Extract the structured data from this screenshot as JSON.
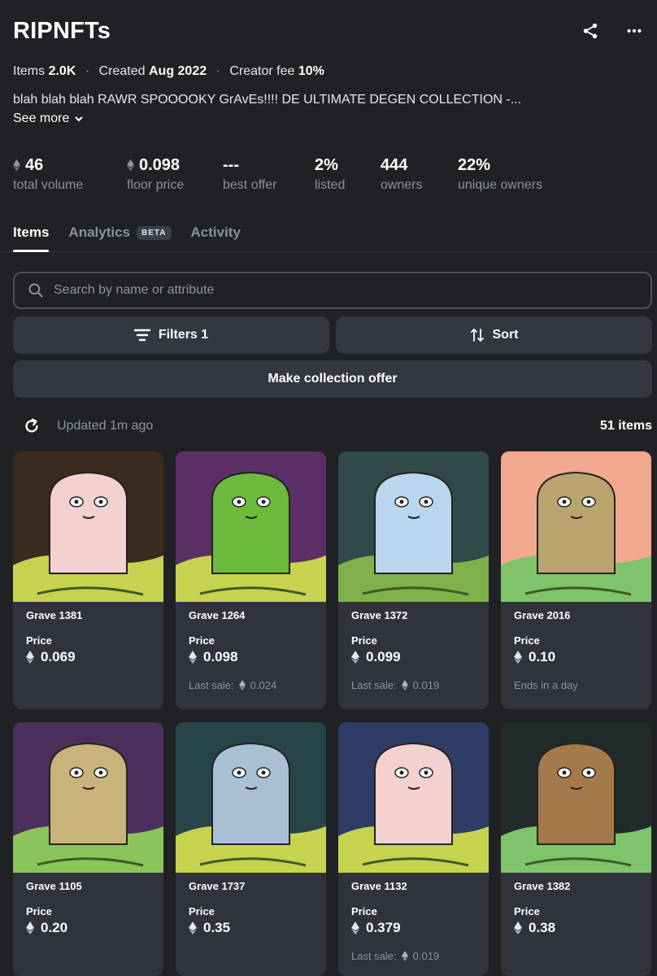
{
  "collection": {
    "title": "RIPNFTs"
  },
  "meta": {
    "items_label": "Items",
    "items_value": "2.0K",
    "created_label": "Created",
    "created_value": "Aug 2022",
    "fee_label": "Creator fee",
    "fee_value": "10%"
  },
  "description": "blah blah blah RAWR SPOOOOKY GrAvEs!!!! DE ULTIMATE DEGEN COLLECTION -...",
  "see_more": "See more",
  "stats": [
    {
      "value": "46",
      "label": "total volume",
      "eth": true
    },
    {
      "value": "0.098",
      "label": "floor price",
      "eth": true
    },
    {
      "value": "---",
      "label": "best offer",
      "eth": false
    },
    {
      "value": "2%",
      "label": "listed",
      "eth": false
    },
    {
      "value": "444",
      "label": "owners",
      "eth": false
    },
    {
      "value": "22%",
      "label": "unique owners",
      "eth": false
    }
  ],
  "tabs": {
    "items": "Items",
    "analytics": "Analytics",
    "beta": "BETA",
    "activity": "Activity"
  },
  "search": {
    "placeholder": "Search by name or attribute"
  },
  "buttons": {
    "filters": "Filters 1",
    "sort": "Sort",
    "offer": "Make collection offer"
  },
  "status": {
    "updated": "Updated 1m ago",
    "count": "51 items"
  },
  "colors": {
    "background": "#202125",
    "card": "#303339",
    "button": "#34373e",
    "muted": "#8a939b"
  },
  "cards": [
    {
      "name": "Grave 1381",
      "price_label": "Price",
      "price": "0.069",
      "sub": "",
      "bg": "#3b2a1e",
      "ground": "#c7d34e",
      "stone": "#f3d1cf"
    },
    {
      "name": "Grave 1264",
      "price_label": "Price",
      "price": "0.098",
      "sub_label": "Last sale:",
      "sub_price": "0.024",
      "bg": "#5a2f66",
      "ground": "#c7d34e",
      "stone": "#6dbb3e"
    },
    {
      "name": "Grave 1372",
      "price_label": "Price",
      "price": "0.099",
      "sub_label": "Last sale:",
      "sub_price": "0.019",
      "bg": "#2f4a48",
      "ground": "#7fb14a",
      "stone": "#b9d6ee"
    },
    {
      "name": "Grave 2016",
      "price_label": "Price",
      "price": "0.10",
      "sub": "Ends in a day",
      "bg": "#f2a98f",
      "ground": "#7fc46a",
      "stone": "#b8a46c"
    },
    {
      "name": "Grave 1105",
      "price_label": "Price",
      "price": "0.20",
      "sub": "",
      "bg": "#4b2f5a",
      "ground": "#8bc45a",
      "stone": "#c9b37a"
    },
    {
      "name": "Grave 1737",
      "price_label": "Price",
      "price": "0.35",
      "sub": "",
      "bg": "#274548",
      "ground": "#c7d34e",
      "stone": "#a9bfd4"
    },
    {
      "name": "Grave 1132",
      "price_label": "Price",
      "price": "0.379",
      "sub_label": "Last sale:",
      "sub_price": "0.019",
      "bg": "#2e3c66",
      "ground": "#c7d34e",
      "stone": "#f3d1cf"
    },
    {
      "name": "Grave 1382",
      "price_label": "Price",
      "price": "0.38",
      "sub": "",
      "bg": "#202b2a",
      "ground": "#7fc46a",
      "stone": "#a47a4a"
    }
  ]
}
